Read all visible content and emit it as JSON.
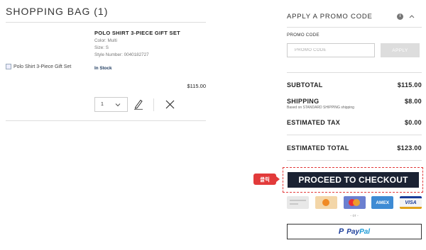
{
  "bag": {
    "title": "SHOPPING BAG (1)"
  },
  "product": {
    "image_alt": "Polo Shirt 3-Piece Gift Set",
    "name": "POLO SHIRT 3-PIECE GIFT SET",
    "color": "Color: Multi",
    "size": "Size: S",
    "style": "Style Number: 0040182727",
    "stock": "In Stock",
    "price": "$115.00",
    "quantity": "1"
  },
  "promo": {
    "header": "APPLY A PROMO CODE",
    "label": "PROMO CODE",
    "placeholder": "PROMO CODE",
    "apply_label": "APPLY"
  },
  "summary": {
    "subtotal_label": "SUBTOTAL",
    "subtotal_value": "$115.00",
    "shipping_label": "SHIPPING",
    "shipping_value": "$8.00",
    "shipping_note": "Based on STANDARD SHIPPING shipping",
    "tax_label": "ESTIMATED TAX",
    "tax_value": "$0.00",
    "total_label": "ESTIMATED TOTAL",
    "total_value": "$123.00"
  },
  "checkout": {
    "button_label": "PROCEED TO CHECKOUT",
    "click_tag": "클릭"
  },
  "payment": {
    "cards": [
      "card-generic",
      "discover",
      "mastercard",
      "AMEX",
      "VISA"
    ],
    "amex_label": "AMEX",
    "visa_label": "VISA",
    "or_text": "- or -",
    "paypal_mark": "P",
    "paypal_pay": "Pay",
    "paypal_pal": "Pal"
  },
  "colors": {
    "checkout_bg": "#1b2233",
    "click_red": "#e23a3a",
    "paypal_blue": "#1a3c99",
    "stock_blue": "#1e3a5f"
  }
}
